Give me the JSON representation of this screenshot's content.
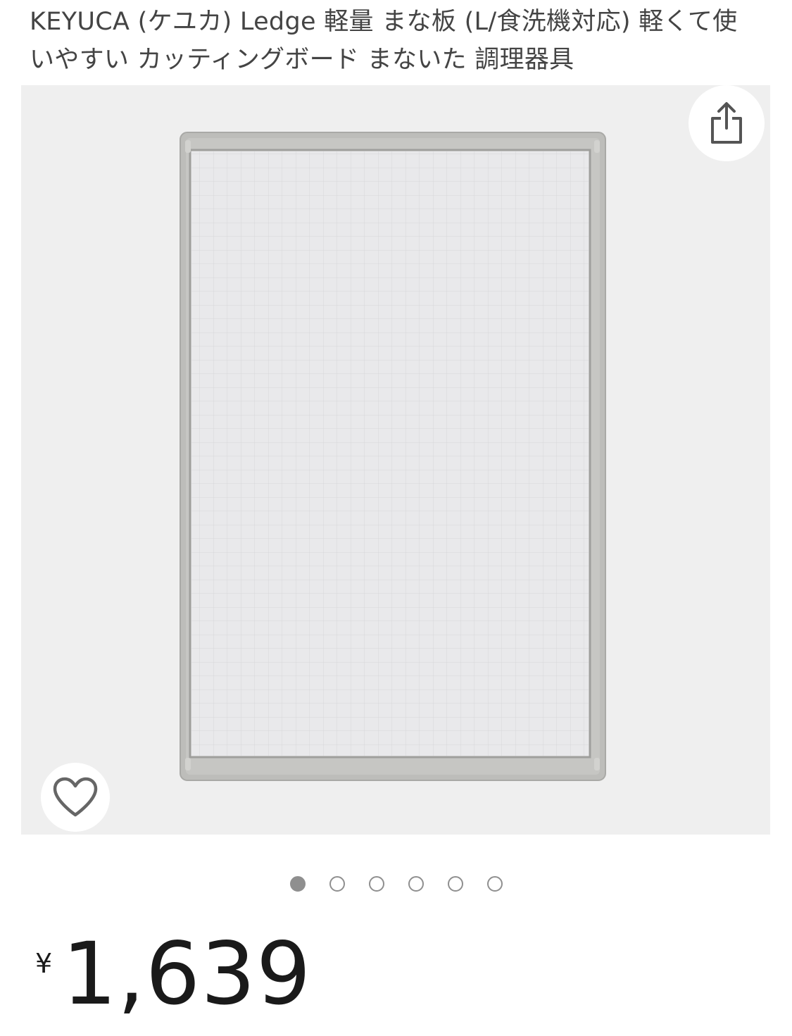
{
  "product": {
    "title": "KEYUCA (ケユカ) Ledge 軽量 まな板 (L/食洗機対応) 軽くて使いやすい カッティングボード まないた 調理器具"
  },
  "actions": {
    "share_icon": "share-icon",
    "like_icon": "heart-icon"
  },
  "carousel": {
    "total": 6,
    "current": 1
  },
  "price": {
    "currency": "¥",
    "amount": "1,639"
  },
  "colors": {
    "image_bg": "#efefef",
    "board_frame": "#b9b9b6",
    "board_surface": "#e8e8ea",
    "dot": "#8f8f8f"
  }
}
